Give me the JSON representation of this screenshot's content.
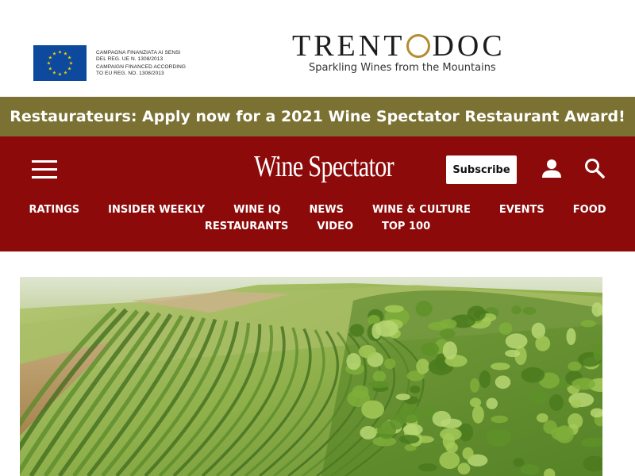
{
  "ad": {
    "eu_text_lines": [
      "CAMPAGNA FINANZIATA AI SENSI",
      "DEL REG. UE N. 1308/2013",
      "CAMPAIGN FINANCED ACCORDING",
      "TO EU REG. NO. 1308/2013"
    ],
    "brand_logo": "TRENTODOC",
    "tagline": "Sparkling Wines from the Mountains",
    "colors": {
      "eu_blue": "#0d4a9e",
      "eu_star": "#f5d000",
      "logo_gold": "#b58b2f"
    }
  },
  "promo": {
    "text": "Restaurateurs: Apply now for a 2021 Wine Spectator Restaurant Award!",
    "background": "#7b7132"
  },
  "header": {
    "background": "#8c0a0a",
    "brand": "Wine Spectator",
    "subscribe_label": "Subscribe",
    "menu_icon": "hamburger-menu-icon",
    "user_icon": "user-icon",
    "search_icon": "search-icon"
  },
  "nav": {
    "row1": [
      "RATINGS",
      "INSIDER WEEKLY",
      "WINE IQ",
      "NEWS",
      "WINE & CULTURE",
      "EVENTS",
      "FOOD"
    ],
    "row2": [
      "RESTAURANTS",
      "VIDEO",
      "TOP 100"
    ]
  },
  "hero": {
    "image": "vineyard-hillside-photo"
  }
}
